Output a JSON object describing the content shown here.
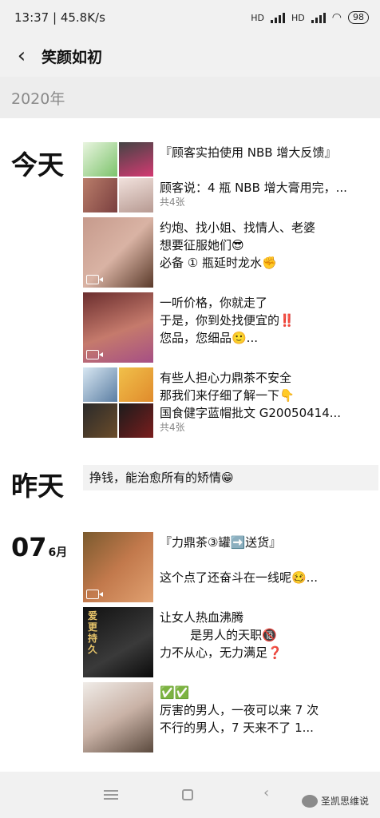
{
  "status": {
    "time": "13:37 | 45.8K/s",
    "net1": "HD",
    "net2": "HD",
    "battery": "98"
  },
  "nav": {
    "title": "笑颜如初"
  },
  "year": "2020年",
  "dates": {
    "today": "今天",
    "yesterday": "昨天",
    "day": "07",
    "month": "6月"
  },
  "entries": [
    {
      "text": "『顾客实拍使用 NBB 增大反馈』\n\n顾客说：4 瓶 NBB 增大膏用完，...",
      "count": "共4张"
    },
    {
      "text": "约炮、找小姐、找情人、老婆\n想要征服她们😎\n必备 ① 瓶延时龙水✊"
    },
    {
      "text": "一听价格，你就走了\n于是，你到处找便宜的‼️\n您品，您细品🙂..."
    },
    {
      "text": "有些人担心力鼎茶不安全\n那我们来仔细了解一下👇\n国食健字蓝帽批文 G20050414...",
      "count": "共4张"
    },
    {
      "text": "『力鼎茶③罐➡️送货』\n\n这个点了还奋斗在一线呢🥴..."
    },
    {
      "text": "让女人热血沸腾\n        是男人的天职🔞\n力不从心，无力满足❓"
    },
    {
      "text": "✅✅\n厉害的男人，一夜可以来 7 次\n不行的男人，7 天来不了 1..."
    }
  ],
  "text_post": "挣钱，能治愈所有的矫情😁",
  "thumb_text": "爱\n更\n持\n久",
  "watermark": "圣凯思维说",
  "colors": {
    "bars": "#f1f1f1",
    "year_bg": "#ededed",
    "text_post_bg": "#f2f2f2"
  }
}
